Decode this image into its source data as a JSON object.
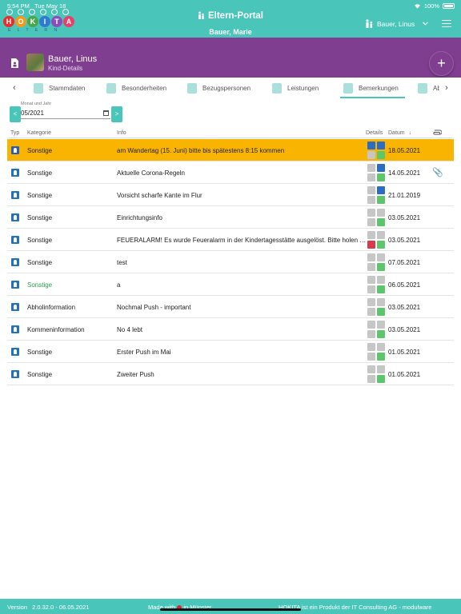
{
  "status": {
    "time": "5:54 PM",
    "date": "Tue May 18",
    "battery": "100%"
  },
  "header": {
    "title": "Eltern-Portal",
    "user": "Bauer, Marie",
    "account_menu": "Bauer, Linus"
  },
  "logo": {
    "letters": [
      "H",
      "O",
      "K",
      "I",
      "T",
      "A"
    ],
    "subtitle": "ELTERN",
    "colors": [
      "#e52f2f",
      "#f29a1f",
      "#4aa64a",
      "#2d7bd2",
      "#8b4fb8",
      "#e8406a"
    ]
  },
  "child": {
    "name": "Bauer, Linus",
    "subtitle": "Kind-Details"
  },
  "tabs": [
    {
      "label": "Stammdaten",
      "icon": "person-icon"
    },
    {
      "label": "Besonderheiten",
      "icon": "hourglass-icon"
    },
    {
      "label": "Bezugspersonen",
      "icon": "people-icon"
    },
    {
      "label": "Leistungen",
      "icon": "services-icon"
    },
    {
      "label": "Bemerkungen",
      "icon": "notes-icon",
      "active": true
    },
    {
      "label": "Ab",
      "icon": "person-icon"
    }
  ],
  "month": {
    "label": "Monat und Jahr",
    "value": "05/2021",
    "prev": "<",
    "next": ">"
  },
  "table": {
    "headers": {
      "typ": "Typ",
      "kategorie": "Kategorie",
      "info": "Info",
      "details": "Details",
      "datum": "Datum"
    },
    "rows": [
      {
        "kategorie": "Sonstige",
        "info": "am Wandertag (15. Juni) bitte bis spätestens 8:15 kommen",
        "datum": "18.05.2021",
        "highlight": true
      },
      {
        "kategorie": "Sonstige",
        "info": "Aktuelle Corona-Regeln",
        "datum": "14.05.2021",
        "attachment": true
      },
      {
        "kategorie": "Sonstige",
        "info": "Vorsicht scharfe Kante im Flur",
        "datum": "21.01.2019"
      },
      {
        "kategorie": "Sonstige",
        "info": "Einrichtungsinfo",
        "datum": "03.05.2021"
      },
      {
        "kategorie": "Sonstige",
        "info": "FEUERALARM! Es wurde Feueralarm in der Kindertagesstätte ausgelöst. Bitte holen Sie Ihr Kind ab.",
        "datum": "03.05.2021",
        "alert": true
      },
      {
        "kategorie": "Sonstige",
        "info": "test",
        "datum": "07.05.2021"
      },
      {
        "kategorie": "Sonstige",
        "info": "a",
        "datum": "06.05.2021",
        "green": true
      },
      {
        "kategorie": "Abholinformation",
        "info": "Nochmal Push - important",
        "datum": "03.05.2021"
      },
      {
        "kategorie": "Kommeninformation",
        "info": "No 4 lebt",
        "datum": "03.05.2021"
      },
      {
        "kategorie": "Sonstige",
        "info": "Erster Push im Mai",
        "datum": "01.05.2021"
      },
      {
        "kategorie": "Sonstige",
        "info": "Zweiter Push",
        "datum": "01.05.2021"
      }
    ]
  },
  "footer": {
    "version_label": "Version",
    "version": "2.0.32.0 - 06.05.2021",
    "made_with": "Made with",
    "made_in": "in Münster",
    "product": "HOKITA ist ein Produkt der IT Consulting AG - modulware"
  },
  "colors": {
    "teal": "#49c5b9",
    "purple": "#7f3e8f",
    "highlight": "#f8b400",
    "blue": "#2672b8",
    "green": "#5cc76a"
  }
}
